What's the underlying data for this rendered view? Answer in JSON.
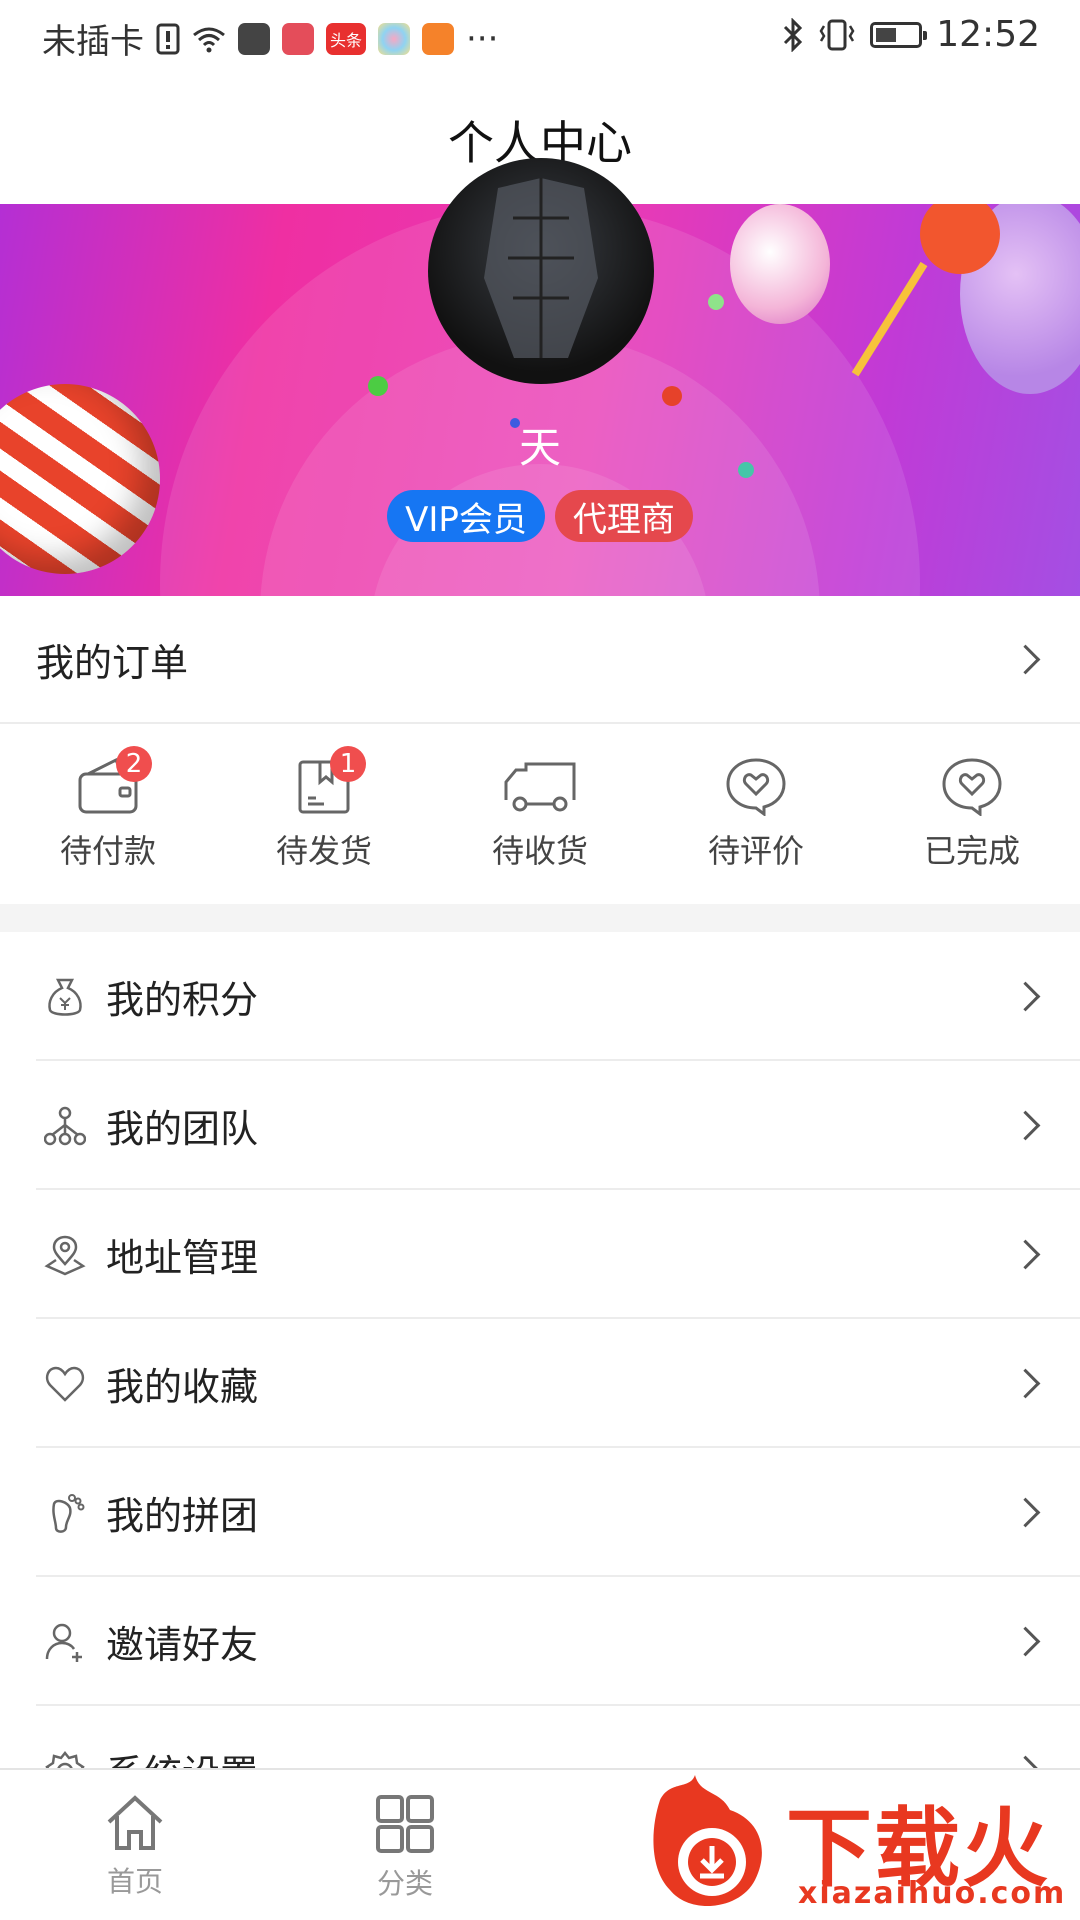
{
  "status_bar": {
    "carrier": "未插卡",
    "time": "12:52",
    "app_icon_badge": "头条",
    "more": "···"
  },
  "header": {
    "title": "个人中心"
  },
  "profile": {
    "name": "天",
    "badges": [
      "VIP会员",
      "代理商"
    ]
  },
  "orders": {
    "title": "我的订单",
    "items": [
      {
        "label": "待付款",
        "count": "2",
        "icon": "wallet-icon"
      },
      {
        "label": "待发货",
        "count": "1",
        "icon": "package-icon"
      },
      {
        "label": "待收货",
        "count": "",
        "icon": "truck-icon"
      },
      {
        "label": "待评价",
        "count": "",
        "icon": "comment-heart-icon"
      },
      {
        "label": "已完成",
        "count": "",
        "icon": "done-heart-icon"
      }
    ]
  },
  "menu": [
    {
      "label": "我的积分",
      "icon": "money-bag-icon"
    },
    {
      "label": "我的团队",
      "icon": "team-icon"
    },
    {
      "label": "地址管理",
      "icon": "location-icon"
    },
    {
      "label": "我的收藏",
      "icon": "heart-icon"
    },
    {
      "label": "我的拼团",
      "icon": "footprint-icon"
    },
    {
      "label": "邀请好友",
      "icon": "add-user-icon"
    },
    {
      "label": "系统设置",
      "icon": "settings-icon"
    }
  ],
  "tabbar": [
    {
      "label": "首页",
      "icon": "home-icon"
    },
    {
      "label": "分类",
      "icon": "grid-icon"
    }
  ],
  "watermark": {
    "text": "下载火",
    "url": "xiazaihuo.com"
  },
  "colors": {
    "vip": "#1676f3",
    "agent": "#e5484d",
    "badge_dot": "#f04e4e"
  }
}
